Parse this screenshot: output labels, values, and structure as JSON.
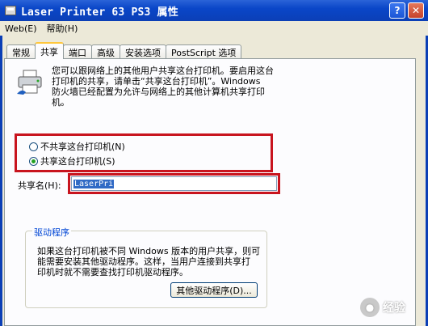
{
  "window": {
    "title": "Laser Printer 63 PS3 属性",
    "help_glyph": "?",
    "close_glyph": "✕"
  },
  "menubar": {
    "items": [
      "Web(E)",
      "帮助(H)"
    ]
  },
  "tabs": [
    "常规",
    "共享",
    "端口",
    "高级",
    "安装选项",
    "PostScript 选项"
  ],
  "active_tab": "共享",
  "sharing": {
    "intro": "您可以跟网络上的其他用户共享这台打印机。要启用这台\n打印机的共享，请单击“共享这台打印机”。Windows\n防火墙已经配置为允许与网络上的其他计算机共享打印\n机。",
    "radio_not_share": "不共享这台打印机(N)",
    "radio_share": "共享这台打印机(S)",
    "share_name_label": "共享名(H):",
    "share_name_value": "LaserPri",
    "selected_option": "share"
  },
  "drivers": {
    "legend": "驱动程序",
    "text": "如果这台打印机被不同 Windows 版本的用户共享，则可\n能需要安装其他驱动程序。这样，当用户连接到共享打\n印机时就不需要查找打印机驱动程序。",
    "button": "其他驱动程序(D)..."
  },
  "watermark": {
    "text": "经验",
    "icon": "baidu-paw-icon"
  },
  "colors": {
    "titlebar": "#0a46c8",
    "highlight_box": "#c8141e",
    "selection": "#316ac5"
  }
}
